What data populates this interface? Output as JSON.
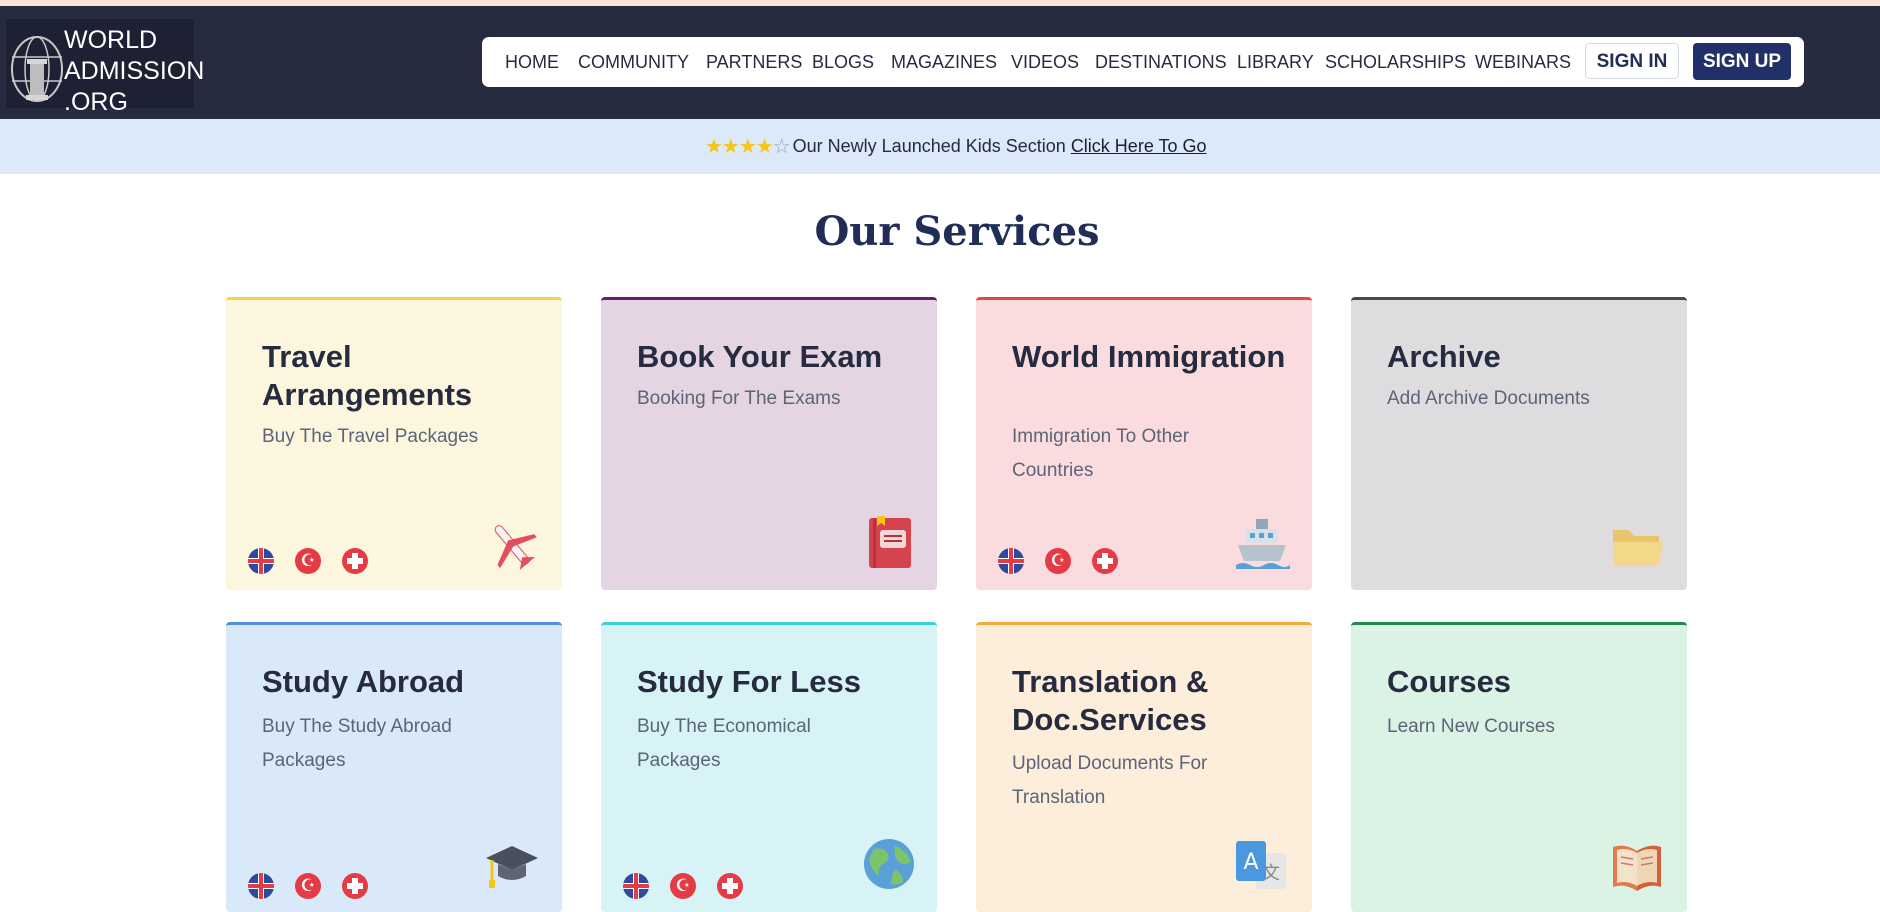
{
  "logo": {
    "line1": "WORLD",
    "line2": "ADMISSION",
    "line3": ".ORG"
  },
  "nav": {
    "links": [
      "HOME",
      "COMMUNITY",
      "PARTNERS",
      "BLOGS",
      "MAGAZINES",
      "VIDEOS",
      "DESTINATIONS",
      "LIBRARY",
      "SCHOLARSHIPS",
      "WEBINARS"
    ],
    "sign_in": "SIGN IN",
    "sign_up": "SIGN UP"
  },
  "banner": {
    "rating": 4,
    "rating_max": 5,
    "text": "Our Newly Launched Kids Section",
    "link": "Click Here To Go"
  },
  "section_title": "Our Services",
  "cards": [
    {
      "title": "Travel Arrangements",
      "subtitle": "Buy The Travel Packages",
      "icon": "airplane-icon",
      "flags": true,
      "bg": "#fdf6df",
      "accent": "#f6d441"
    },
    {
      "title": "Book Your Exam",
      "subtitle": "Booking For The Exams",
      "icon": "book-icon",
      "flags": false,
      "bg": "#e5d5e2",
      "accent": "#6a1e67"
    },
    {
      "title": "World Immigration",
      "subtitle": "Immigration To Other Countries",
      "icon": "ship-icon",
      "flags": true,
      "bg": "#fadcdf",
      "accent": "#e0484e"
    },
    {
      "title": "Archive",
      "subtitle": "Add Archive Documents",
      "icon": "folder-icon",
      "flags": false,
      "bg": "#dedcde",
      "accent": "#4a4a4a"
    },
    {
      "title": "Study Abroad",
      "subtitle": "Buy The Study Abroad Packages",
      "icon": "graduation-cap-icon",
      "flags": true,
      "bg": "#dae9f9",
      "accent": "#4f8fe0"
    },
    {
      "title": "Study For Less",
      "subtitle": "Buy The Economical Packages",
      "icon": "globe-icon",
      "flags": true,
      "bg": "#d8f3f5",
      "accent": "#3fd0d3"
    },
    {
      "title": "Translation & Doc.Services",
      "subtitle": "Upload Documents For Translation",
      "icon": "translate-icon",
      "flags": false,
      "bg": "#fdeedb",
      "accent": "#f6a83c"
    },
    {
      "title": "Courses",
      "subtitle": "Learn New Courses",
      "icon": "open-book-icon",
      "flags": false,
      "bg": "#dbf3e4",
      "accent": "#1f8a4c"
    }
  ]
}
